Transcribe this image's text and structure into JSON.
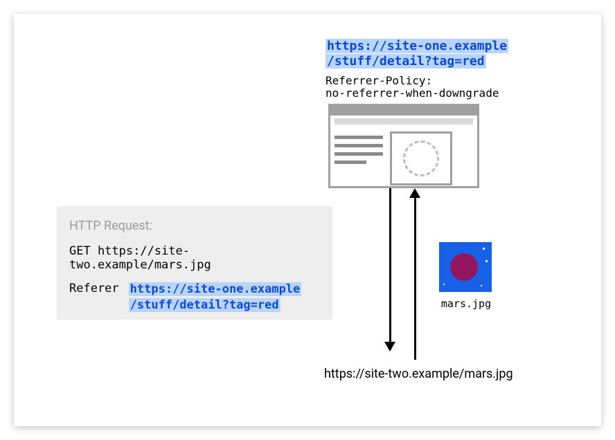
{
  "source_url_line1": "https://site-one.example",
  "source_url_line2": "/stuff/detail?tag=red",
  "referer_policy_line1": "Referrer-Policy:",
  "referer_policy_line2": "no-referrer-when-downgrade",
  "http": {
    "title": "HTTP Request:",
    "get": "GET https://site-two.example/mars.jpg",
    "referer_label": "Referer",
    "referer_value_line1": "https://site-one.example",
    "referer_value_line2": "/stuff/detail?tag=red"
  },
  "mars": {
    "filename": "mars.jpg"
  },
  "target_url": "https://site-two.example/mars.jpg"
}
